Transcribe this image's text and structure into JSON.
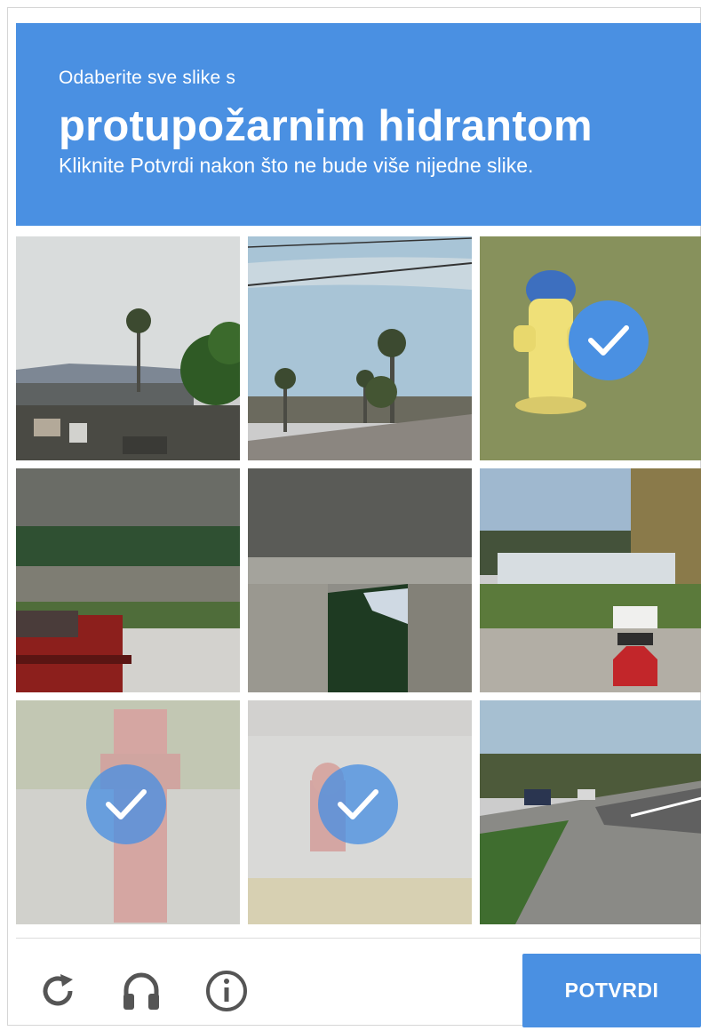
{
  "header": {
    "instruction_prefix": "Odaberite sve slike s",
    "target_object": "protupožarnim hidrantom",
    "instruction_suffix": "Kliknite Potvrdi nakon što ne bude više nijedne slike."
  },
  "grid": {
    "tiles": [
      {
        "scene": "palm-tree-overpass",
        "selected": false
      },
      {
        "scene": "street-power-lines-palms",
        "selected": false
      },
      {
        "scene": "yellow-fire-hydrant-grass",
        "selected": true
      },
      {
        "scene": "highway-barrier-red-car",
        "selected": false
      },
      {
        "scene": "concrete-bridge-pillar",
        "selected": false
      },
      {
        "scene": "stop-sign-boats",
        "selected": false
      },
      {
        "scene": "red-fire-hydrant-faded",
        "selected": true
      },
      {
        "scene": "small-red-hydrant-sidewalk-faded",
        "selected": true
      },
      {
        "scene": "road-with-cars",
        "selected": false
      }
    ]
  },
  "footer": {
    "reload_icon": "reload-icon",
    "audio_icon": "headphones-icon",
    "info_icon": "info-icon",
    "verify_label": "POTVRDI"
  },
  "colors": {
    "accent": "#4a90e2"
  }
}
